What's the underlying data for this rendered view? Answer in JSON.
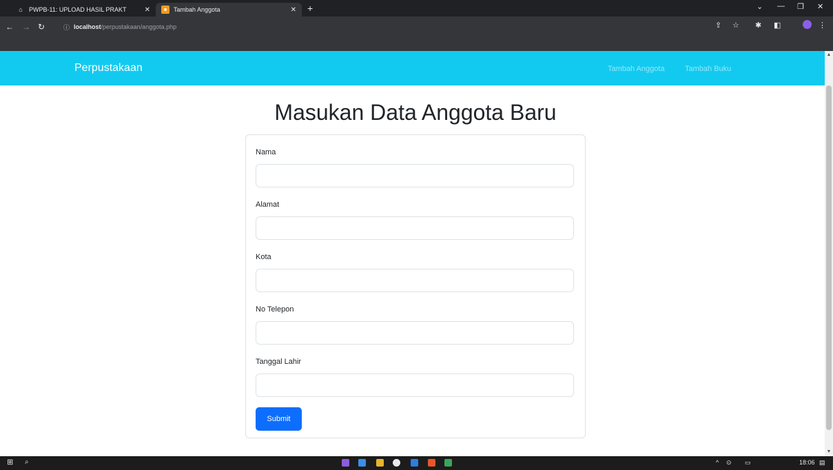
{
  "browser": {
    "tabs": [
      {
        "title": "PWPB-11: UPLOAD HASIL PRAKT",
        "active": false
      },
      {
        "title": "Tambah Anggota",
        "active": true
      }
    ],
    "address": {
      "host": "localhost",
      "path": "/perpustakaan/anggota.php"
    },
    "accent_color": "#12caf0"
  },
  "navbar": {
    "brand": "Perpustakaan",
    "links": [
      "Tambah Anggota",
      "Tambah Buku"
    ]
  },
  "main": {
    "title": "Masukan Data Anggota Baru",
    "fields": [
      {
        "label": "Nama",
        "value": ""
      },
      {
        "label": "Alamat",
        "value": ""
      },
      {
        "label": "Kota",
        "value": ""
      },
      {
        "label": "No Telepon",
        "value": ""
      },
      {
        "label": "Tanggal Lahir",
        "value": ""
      }
    ],
    "submit_label": "Submit",
    "submit_color": "#0d6efd"
  },
  "taskbar": {
    "clock": "18:06"
  }
}
